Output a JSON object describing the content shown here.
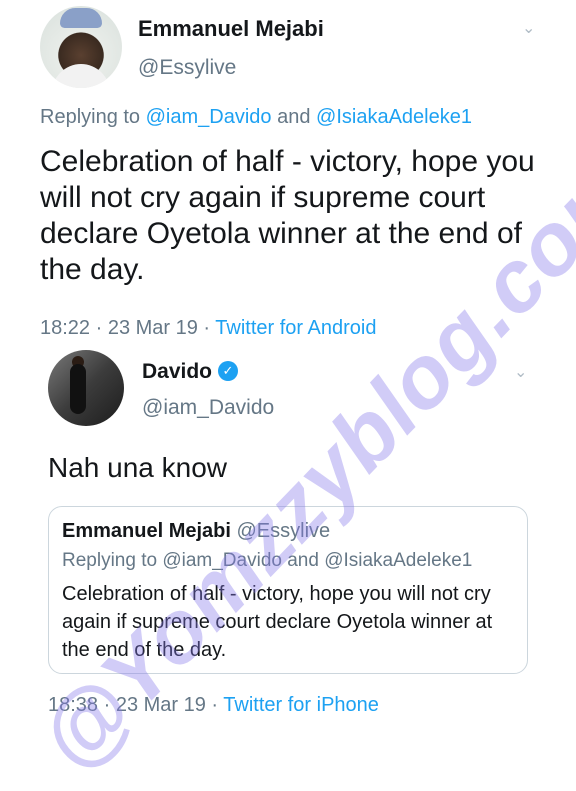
{
  "tweet": {
    "author_name": "Emmanuel Mejabi",
    "author_handle": "@Essylive",
    "replying_prefix": "Replying to",
    "reply_to_1": "@iam_Davido",
    "reply_and": "and",
    "reply_to_2": "@IsiakaAdeleke1",
    "text": "Celebration of half - victory, hope you will not cry again if supreme court declare Oyetola winner at the end of the day.",
    "time": "18:22 · 23 Mar 19 ·",
    "source": "Twitter for Android"
  },
  "reply": {
    "author_name": "Davido",
    "author_handle": "@iam_Davido",
    "text": "Nah una know",
    "time": "18:38 · 23 Mar 19 ·",
    "source": "Twitter for iPhone"
  },
  "quoted": {
    "author_name": "Emmanuel Mejabi",
    "author_handle": "@Essylive",
    "replying_line": "Replying to @iam_Davido and @IsiakaAdeleke1",
    "text": "Celebration of half - victory, hope you will not cry again if supreme court declare Oyetola winner at the end of the day."
  },
  "watermark": "@Yomzzyblog.com",
  "icons": {
    "verified": "verified-badge-icon",
    "chevron": "chevron-down-icon"
  },
  "colors": {
    "link": "#1da1f2",
    "muted": "#657786",
    "watermark": "#8778eb"
  }
}
